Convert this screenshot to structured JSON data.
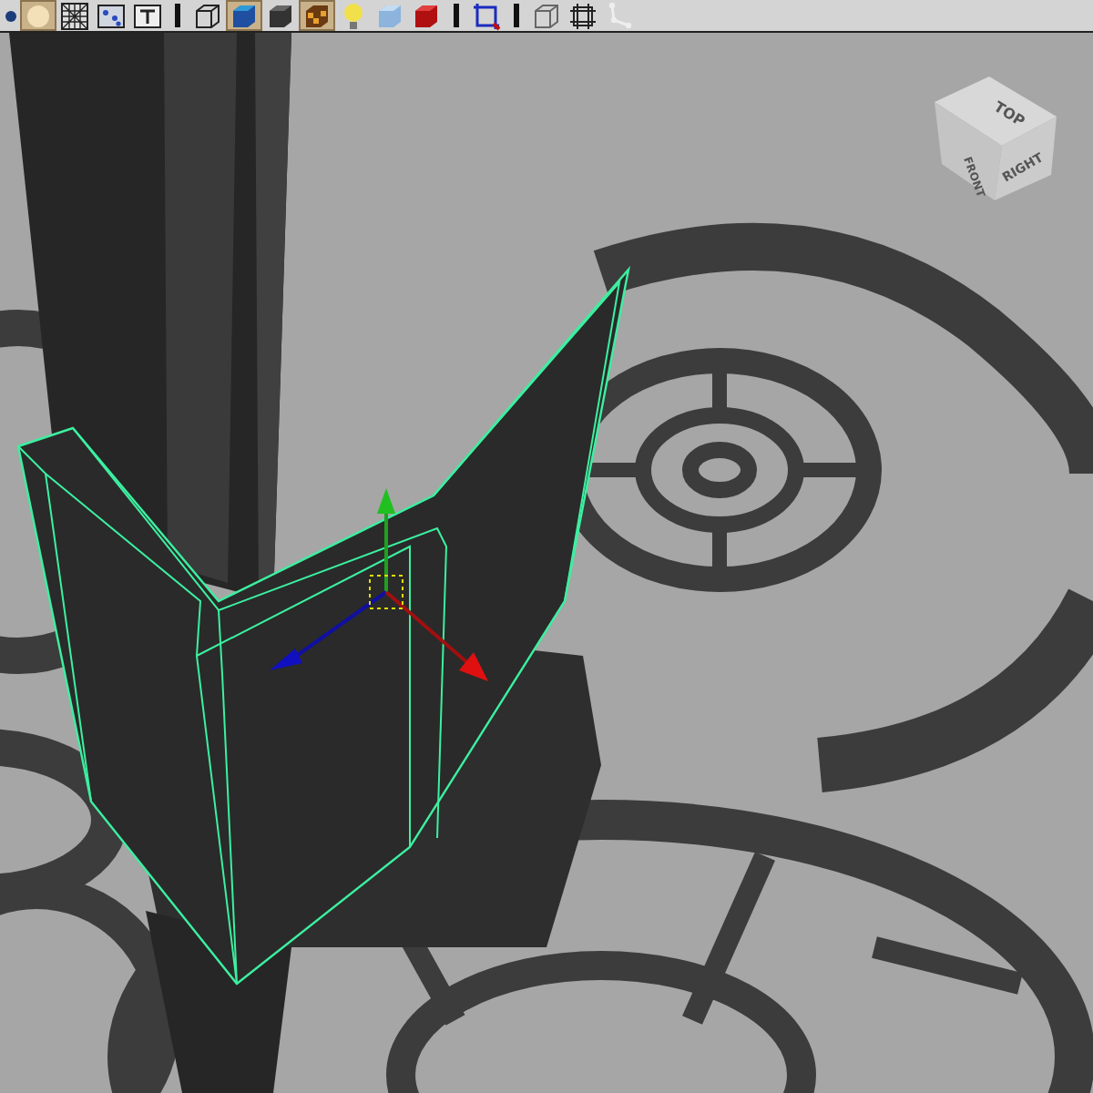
{
  "toolbar": [
    {
      "kind": "dot",
      "on": false
    },
    {
      "kind": "sphere",
      "on": true
    },
    {
      "kind": "grid",
      "on": false
    },
    {
      "kind": "image",
      "on": false
    },
    {
      "kind": "text",
      "on": false
    },
    {
      "kind": "separator"
    },
    {
      "kind": "wirecube",
      "on": false
    },
    {
      "kind": "bluecube",
      "on": true
    },
    {
      "kind": "darkcube",
      "on": false
    },
    {
      "kind": "checker",
      "on": true
    },
    {
      "kind": "bulb",
      "on": false
    },
    {
      "kind": "palecube",
      "on": false
    },
    {
      "kind": "redcube",
      "on": false
    },
    {
      "kind": "separator"
    },
    {
      "kind": "gate",
      "on": false
    },
    {
      "kind": "separator"
    },
    {
      "kind": "xray",
      "on": false
    },
    {
      "kind": "frame",
      "on": false
    },
    {
      "kind": "joint",
      "on": false
    }
  ],
  "viewcube": {
    "top": "TOP",
    "front": "FRONT",
    "right": "RIGHT"
  }
}
